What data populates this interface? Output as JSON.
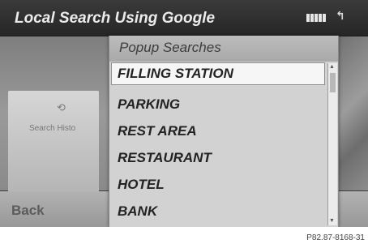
{
  "header": {
    "title": "Local Search Using Google",
    "signal_icon": "signal-strength-icon",
    "phone_icon": "phone-connection-icon"
  },
  "background": {
    "history_tile": {
      "label": "Search Histo",
      "icon": "history-icon"
    }
  },
  "popup": {
    "title": "Popup Searches",
    "items": [
      {
        "label": "FILLING STATION",
        "selected": true
      },
      {
        "label": "PARKING",
        "selected": false
      },
      {
        "label": "REST AREA",
        "selected": false
      },
      {
        "label": "RESTAURANT",
        "selected": false
      },
      {
        "label": "HOTEL",
        "selected": false
      },
      {
        "label": "BANK",
        "selected": false
      }
    ]
  },
  "footer": {
    "back_label": "Back",
    "reference_code": "P82.87-8168-31"
  },
  "colors": {
    "header_bg": "#2e2e2e",
    "popup_bg": "#d2d2d2",
    "selected_bg": "#f6f6f6"
  }
}
